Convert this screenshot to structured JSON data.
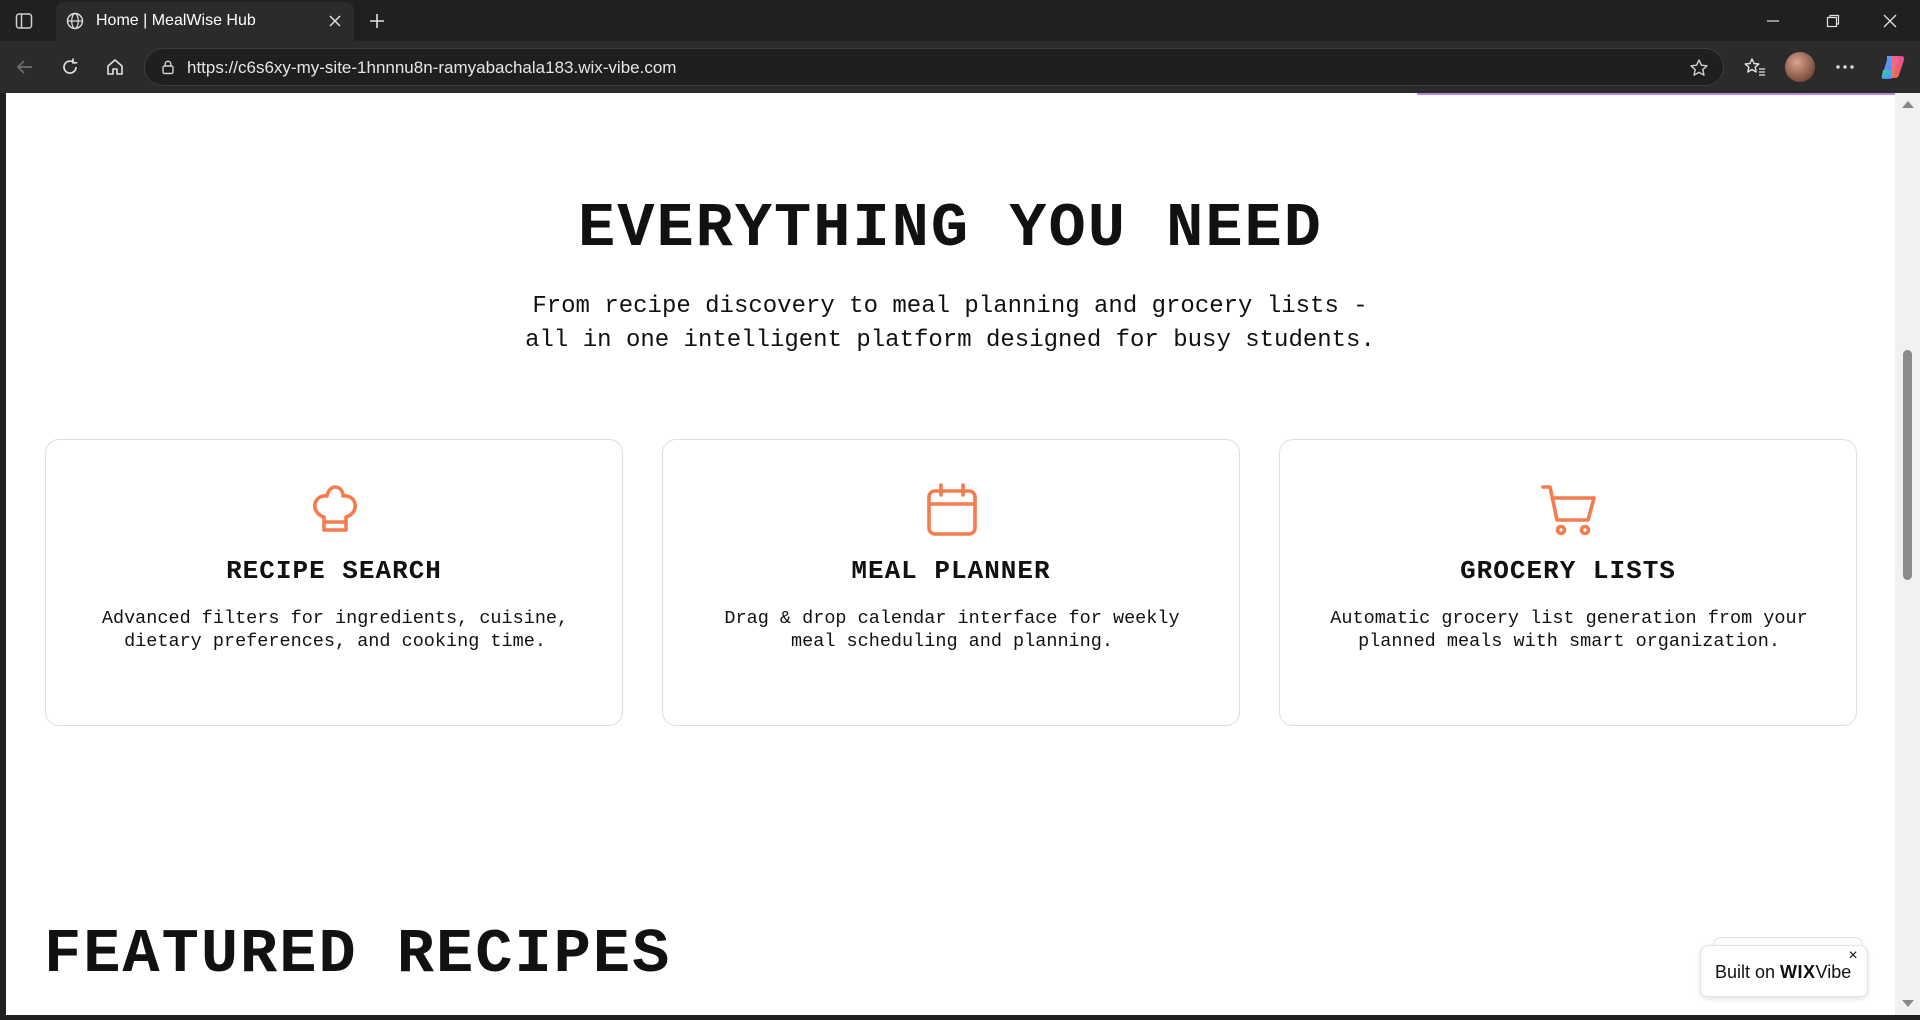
{
  "browser": {
    "tab_title": "Home | MealWise Hub",
    "url": "https://c6s6xy-my-site-1hnnnu8n-ramyabachala183.wix-vibe.com",
    "icons": {
      "sidebar": "tab-sidebar-icon",
      "favicon": "globe-icon",
      "close_tab": "close-icon",
      "new_tab": "plus-icon",
      "minimize": "minimize-icon",
      "restore": "restore-icon",
      "close_window": "close-icon",
      "back": "back-arrow-icon",
      "reload": "reload-icon",
      "home": "home-icon",
      "site_info": "lock-icon",
      "favorite": "star-icon",
      "favorites": "favorites-icon",
      "menu": "more-icon",
      "copilot": "copilot-icon"
    }
  },
  "page": {
    "section_title": "EVERYTHING YOU NEED",
    "section_subtitle_line1": "From recipe discovery to meal planning and grocery lists -",
    "section_subtitle_line2": "all in one intelligent platform designed for busy students.",
    "accent_color": "#f47c4f",
    "features": [
      {
        "icon": "chef-hat-icon",
        "title": "RECIPE SEARCH",
        "description": "Advanced filters for ingredients, cuisine, dietary preferences, and cooking time."
      },
      {
        "icon": "calendar-icon",
        "title": "MEAL PLANNER",
        "description": "Drag & drop calendar interface for weekly meal scheduling and planning."
      },
      {
        "icon": "shopping-cart-icon",
        "title": "GROCERY LISTS",
        "description": "Automatic grocery list generation from your planned meals with smart organization."
      }
    ],
    "featured_title": "FEATURED RECIPES"
  },
  "wix_badge": {
    "prefix": "Built on ",
    "brand": "WIX",
    "suffix": "Vibe",
    "close": "×"
  }
}
